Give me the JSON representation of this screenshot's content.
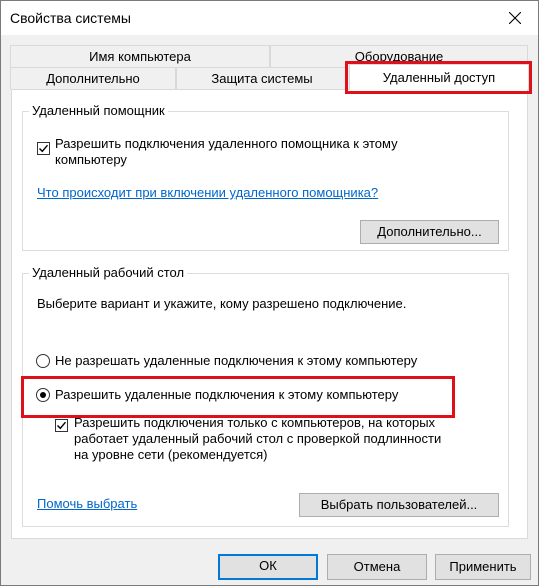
{
  "window": {
    "title": "Свойства системы"
  },
  "tabs": {
    "row1": [
      "Имя компьютера",
      "Оборудование"
    ],
    "row2": [
      "Дополнительно",
      "Защита системы",
      "Удаленный доступ"
    ]
  },
  "assistance": {
    "group_title": "Удаленный помощник",
    "checkbox_label": "Разрешить подключения удаленного помощника к этому\nкомпьютеру",
    "link": "Что происходит при включении удаленного помощника?",
    "advanced_button": "Дополнительно..."
  },
  "desktop": {
    "group_title": "Удаленный рабочий стол",
    "description": "Выберите вариант и укажите, кому разрешено подключение.",
    "option_deny": "Не разрешать удаленные подключения к этому компьютеру",
    "option_allow": "Разрешить удаленные подключения к этому компьютеру",
    "nla_label": "Разрешить подключения только с компьютеров, на которых\nработает удаленный рабочий стол с проверкой подлинности\nна уровне сети (рекомендуется)",
    "help_link": "Помочь выбрать",
    "select_users_button": "Выбрать пользователей..."
  },
  "footer": {
    "ok": "ОК",
    "cancel": "Отмена",
    "apply": "Применить"
  }
}
